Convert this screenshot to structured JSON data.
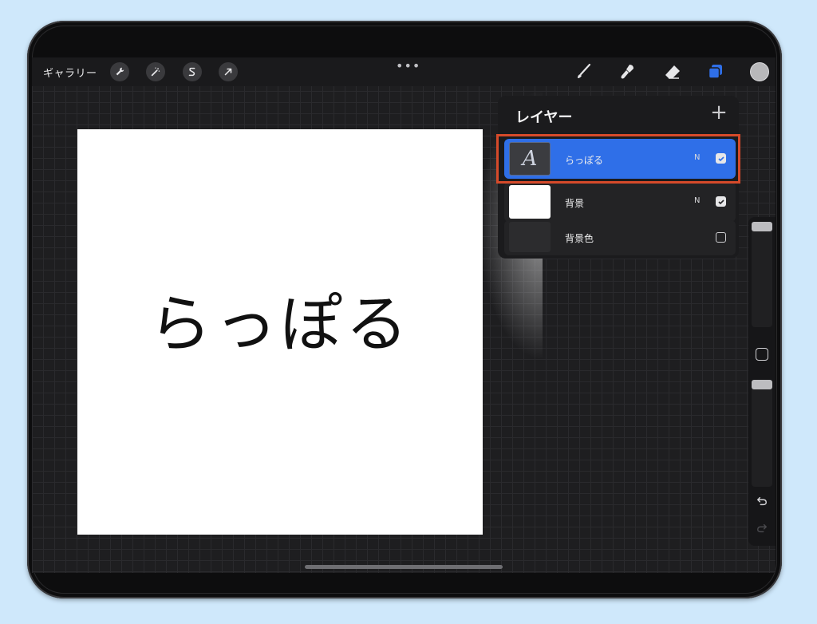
{
  "toolbar": {
    "gallery_label": "ギャラリー",
    "tools_left": [
      "wrench-icon",
      "magic-wand-icon",
      "selection-icon",
      "transform-arrow-icon"
    ],
    "tools_right": [
      "brush-icon",
      "smudge-icon",
      "eraser-icon",
      "layers-icon"
    ],
    "layers_accent": "#2f6fe8",
    "current_color": "#b8b8ba"
  },
  "canvas": {
    "text": "らっぽる"
  },
  "layers_panel": {
    "title": "レイヤー",
    "add_label": "+",
    "layers": [
      {
        "name": "らっぽる",
        "blend": "N",
        "visible": true,
        "selected": true,
        "thumb": "text-layer"
      },
      {
        "name": "背景",
        "blend": "N",
        "visible": true,
        "selected": false,
        "thumb": "white"
      },
      {
        "name": "背景色",
        "blend": "",
        "visible": false,
        "selected": false,
        "thumb": "dark"
      }
    ]
  },
  "highlight_color": "#d64a2a"
}
